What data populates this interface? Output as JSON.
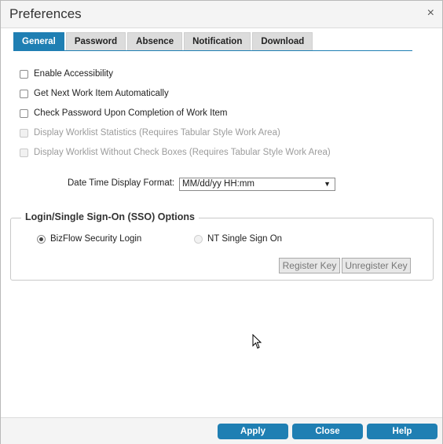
{
  "dialog": {
    "title": "Preferences",
    "close_glyph": "×"
  },
  "tabs": [
    {
      "label": "General",
      "active": true
    },
    {
      "label": "Password",
      "active": false
    },
    {
      "label": "Absence",
      "active": false
    },
    {
      "label": "Notification",
      "active": false
    },
    {
      "label": "Download",
      "active": false
    }
  ],
  "options": [
    {
      "label": "Enable Accessibility",
      "checked": false,
      "disabled": false
    },
    {
      "label": "Get Next Work Item Automatically",
      "checked": false,
      "disabled": false
    },
    {
      "label": "Check Password Upon Completion of Work Item",
      "checked": false,
      "disabled": false
    },
    {
      "label": "Display Worklist Statistics (Requires Tabular Style Work Area)",
      "checked": false,
      "disabled": true
    },
    {
      "label": "Display Worklist Without Check Boxes (Requires Tabular Style Work Area)",
      "checked": false,
      "disabled": true
    }
  ],
  "date_format": {
    "label": "Date Time Display Format:",
    "value": "MM/dd/yy HH:mm"
  },
  "sso": {
    "legend": "Login/Single Sign-On (SSO) Options",
    "bizflow_label": "BizFlow Security Login",
    "nt_label": "NT Single Sign On",
    "register_label": "Register Key",
    "unregister_label": "Unregister Key"
  },
  "footer": {
    "apply_label": "Apply",
    "close_label": "Close",
    "help_label": "Help"
  },
  "colors": {
    "accent": "#1f7fb3"
  },
  "icons": {
    "close": "close-icon",
    "dropdown": "chevron-down-icon",
    "cursor": "mouse-cursor-icon"
  }
}
